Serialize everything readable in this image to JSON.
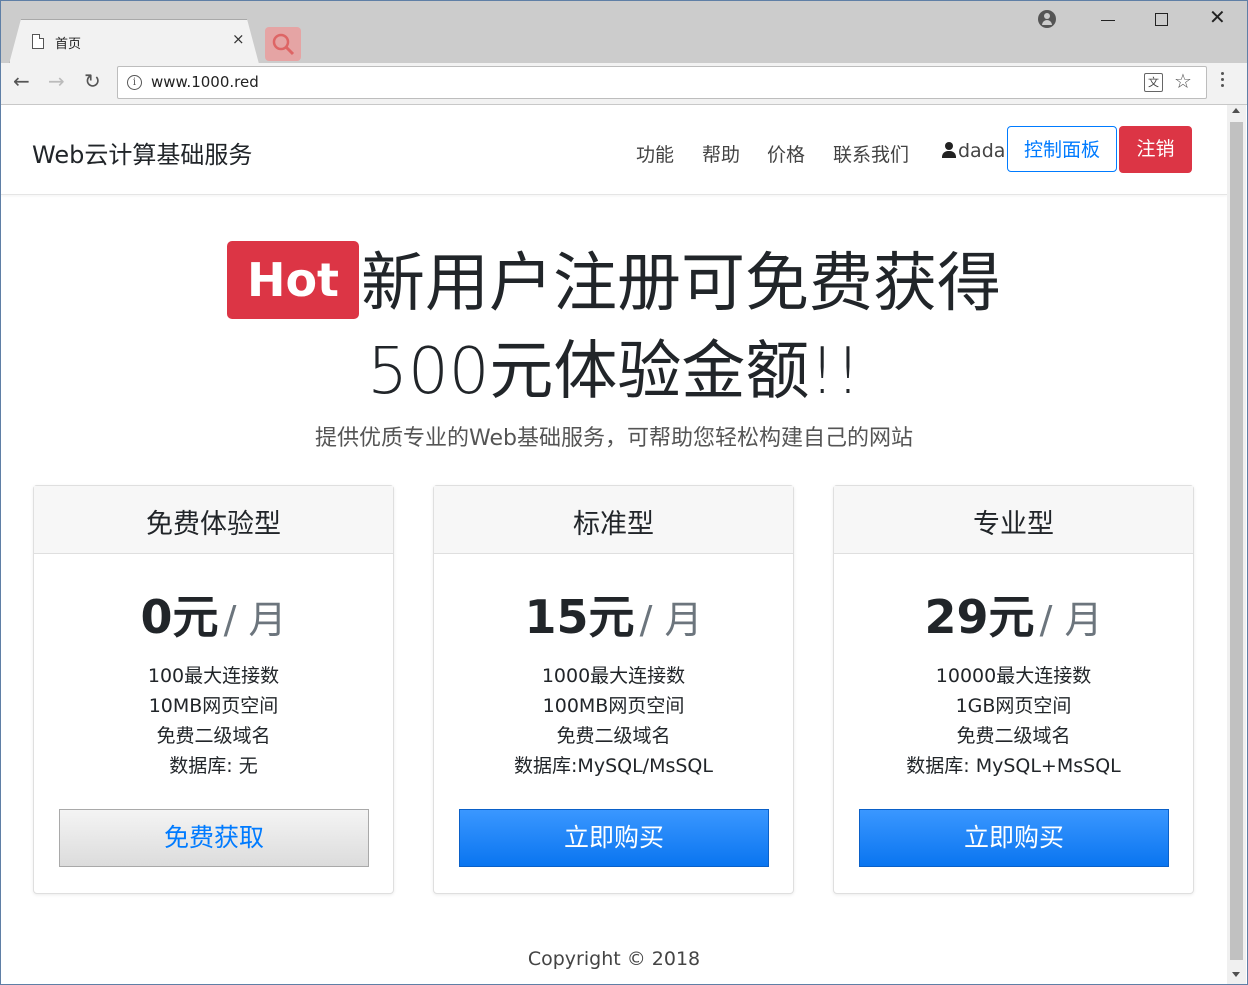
{
  "browser": {
    "tab_title": "首页",
    "tab_close": "×",
    "url": "www.1000.red",
    "info_glyph": "i",
    "translate_glyph": "文",
    "star_glyph": "☆",
    "back_glyph": "←",
    "forward_glyph": "→",
    "reload_glyph": "↻",
    "close_glyph": "✕"
  },
  "navbar": {
    "brand": "Web云计算基础服务",
    "links": [
      "功能",
      "帮助",
      "价格",
      "联系我们"
    ],
    "username": "dada",
    "console_button": "控制面板",
    "logout_button": "注销"
  },
  "hero": {
    "badge": "Hot",
    "headline_1": "新用户注册可免费获得",
    "headline_2": "500元体验金额!!",
    "lead": "提供优质专业的Web基础服务，可帮助您轻松构建自己的网站"
  },
  "plans": [
    {
      "name": "免费体验型",
      "price": "0元",
      "unit": "/ 月",
      "features": [
        "100最大连接数",
        "10MB网页空间",
        "免费二级域名",
        "数据库: 无"
      ],
      "button": "免费获取"
    },
    {
      "name": "标准型",
      "price": "15元",
      "unit": "/ 月",
      "features": [
        "1000最大连接数",
        "100MB网页空间",
        "免费二级域名",
        "数据库:MySQL/MsSQL"
      ],
      "button": "立即购买"
    },
    {
      "name": "专业型",
      "price": "29元",
      "unit": "/ 月",
      "features": [
        "10000最大连接数",
        "1GB网页空间",
        "免费二级域名",
        "数据库: MySQL+MsSQL"
      ],
      "button": "立即购买"
    }
  ],
  "footer": {
    "copyright": "Copyright © 2018"
  },
  "colors": {
    "danger": "#dc3545",
    "primary": "#007bff"
  }
}
